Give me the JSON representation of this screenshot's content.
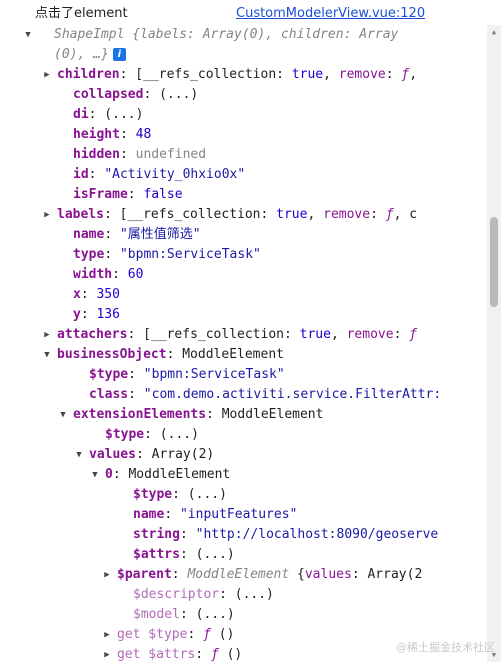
{
  "log": {
    "message": "点击了element",
    "source": "CustomModelerView.vue:120"
  },
  "rows": [
    {
      "kind": "summary",
      "arrow": "down",
      "indent": 38,
      "italic": "ShapeImpl {labels: Array(0), children: Array",
      "cont": "(0), …}",
      "info": "i"
    },
    {
      "kind": "summary-cont"
    },
    {
      "arrow": "right",
      "indent": 57,
      "key": "children",
      "vals": [
        [
          "plain",
          ": [__refs_collection: "
        ],
        [
          "bool",
          "true"
        ],
        [
          "plain",
          ", "
        ],
        [
          "kw",
          "remove"
        ],
        [
          "plain",
          ": "
        ],
        [
          "fn",
          "ƒ"
        ],
        [
          "plain",
          ","
        ]
      ]
    },
    {
      "indent": 73,
      "key": "collapsed",
      "vals": [
        [
          "plain",
          ": (...)"
        ]
      ]
    },
    {
      "indent": 73,
      "key": "di",
      "vals": [
        [
          "plain",
          ": (...)"
        ]
      ]
    },
    {
      "indent": 73,
      "key": "height",
      "vals": [
        [
          "plain",
          ": "
        ],
        [
          "num",
          "48"
        ]
      ]
    },
    {
      "indent": 73,
      "key": "hidden",
      "vals": [
        [
          "plain",
          ": "
        ],
        [
          "undef",
          "undefined"
        ]
      ]
    },
    {
      "indent": 73,
      "key": "id",
      "vals": [
        [
          "plain",
          ": "
        ],
        [
          "str",
          "\"Activity_0hxio0x\""
        ]
      ]
    },
    {
      "indent": 73,
      "key": "isFrame",
      "vals": [
        [
          "plain",
          ": "
        ],
        [
          "bool",
          "false"
        ]
      ]
    },
    {
      "arrow": "right",
      "indent": 57,
      "key": "labels",
      "vals": [
        [
          "plain",
          ": [__refs_collection: "
        ],
        [
          "bool",
          "true"
        ],
        [
          "plain",
          ", "
        ],
        [
          "kw",
          "remove"
        ],
        [
          "plain",
          ": "
        ],
        [
          "fn",
          "ƒ"
        ],
        [
          "plain",
          ", c"
        ]
      ]
    },
    {
      "indent": 73,
      "key": "name",
      "vals": [
        [
          "plain",
          ": "
        ],
        [
          "str",
          "\"属性值筛选\""
        ]
      ]
    },
    {
      "indent": 73,
      "key": "type",
      "vals": [
        [
          "plain",
          ": "
        ],
        [
          "str",
          "\"bpmn:ServiceTask\""
        ]
      ]
    },
    {
      "indent": 73,
      "key": "width",
      "vals": [
        [
          "plain",
          ": "
        ],
        [
          "num",
          "60"
        ]
      ]
    },
    {
      "indent": 73,
      "key": "x",
      "vals": [
        [
          "plain",
          ": "
        ],
        [
          "num",
          "350"
        ]
      ]
    },
    {
      "indent": 73,
      "key": "y",
      "vals": [
        [
          "plain",
          ": "
        ],
        [
          "num",
          "136"
        ]
      ]
    },
    {
      "arrow": "right",
      "indent": 57,
      "key": "attachers",
      "vals": [
        [
          "plain",
          ": [__refs_collection: "
        ],
        [
          "bool",
          "true"
        ],
        [
          "plain",
          ", "
        ],
        [
          "kw",
          "remove"
        ],
        [
          "plain",
          ": "
        ],
        [
          "fn",
          "ƒ"
        ]
      ]
    },
    {
      "arrow": "down",
      "indent": 57,
      "key": "businessObject",
      "vals": [
        [
          "plain",
          ": ModdleElement"
        ]
      ]
    },
    {
      "indent": 89,
      "key": "$type",
      "vals": [
        [
          "plain",
          ": "
        ],
        [
          "str",
          "\"bpmn:ServiceTask\""
        ]
      ]
    },
    {
      "indent": 89,
      "key": "class",
      "vals": [
        [
          "plain",
          ": "
        ],
        [
          "str",
          "\"com.demo.activiti.service.FilterAttr:"
        ]
      ]
    },
    {
      "arrow": "down",
      "indent": 73,
      "key": "extensionElements",
      "vals": [
        [
          "plain",
          ": ModdleElement"
        ]
      ]
    },
    {
      "indent": 105,
      "key": "$type",
      "vals": [
        [
          "plain",
          ": (...)"
        ]
      ]
    },
    {
      "arrow": "down",
      "indent": 89,
      "key": "values",
      "vals": [
        [
          "plain",
          ": Array(2)"
        ]
      ]
    },
    {
      "arrow": "down",
      "indent": 105,
      "key": "0",
      "vals": [
        [
          "plain",
          ": ModdleElement"
        ]
      ]
    },
    {
      "indent": 133,
      "key": "$type",
      "vals": [
        [
          "plain",
          ": (...)"
        ]
      ]
    },
    {
      "indent": 133,
      "key": "name",
      "vals": [
        [
          "plain",
          ": "
        ],
        [
          "str",
          "\"inputFeatures\""
        ]
      ]
    },
    {
      "indent": 133,
      "key": "string",
      "vals": [
        [
          "plain",
          ": "
        ],
        [
          "str",
          "\"http://localhost:8090/geoserve"
        ]
      ]
    },
    {
      "indent": 133,
      "key": "$attrs",
      "vals": [
        [
          "plain",
          ": (...)"
        ]
      ]
    },
    {
      "arrow": "right",
      "indent": 117,
      "key": "$parent",
      "vals": [
        [
          "plain",
          ": "
        ],
        [
          "ital",
          "ModdleElement "
        ],
        [
          "plain",
          "{"
        ],
        [
          "kw",
          "values"
        ],
        [
          "plain",
          ": Array(2"
        ]
      ]
    },
    {
      "indent": 133,
      "key": "$descriptor",
      "dim": true,
      "vals": [
        [
          "plain",
          ": (...)"
        ]
      ]
    },
    {
      "indent": 133,
      "key": "$model",
      "dim": true,
      "vals": [
        [
          "plain",
          ": (...)"
        ]
      ]
    },
    {
      "arrow": "right",
      "indent": 117,
      "key": "get $type",
      "dim": true,
      "vals": [
        [
          "plain",
          ": "
        ],
        [
          "fn",
          "ƒ"
        ],
        [
          "plain",
          " ()"
        ]
      ]
    },
    {
      "arrow": "right",
      "indent": 117,
      "key": "get $attrs",
      "dim": true,
      "vals": [
        [
          "plain",
          ": "
        ],
        [
          "fn",
          "ƒ"
        ],
        [
          "plain",
          " ()"
        ]
      ]
    }
  ],
  "watermark": "@稀土掘金技术社区"
}
